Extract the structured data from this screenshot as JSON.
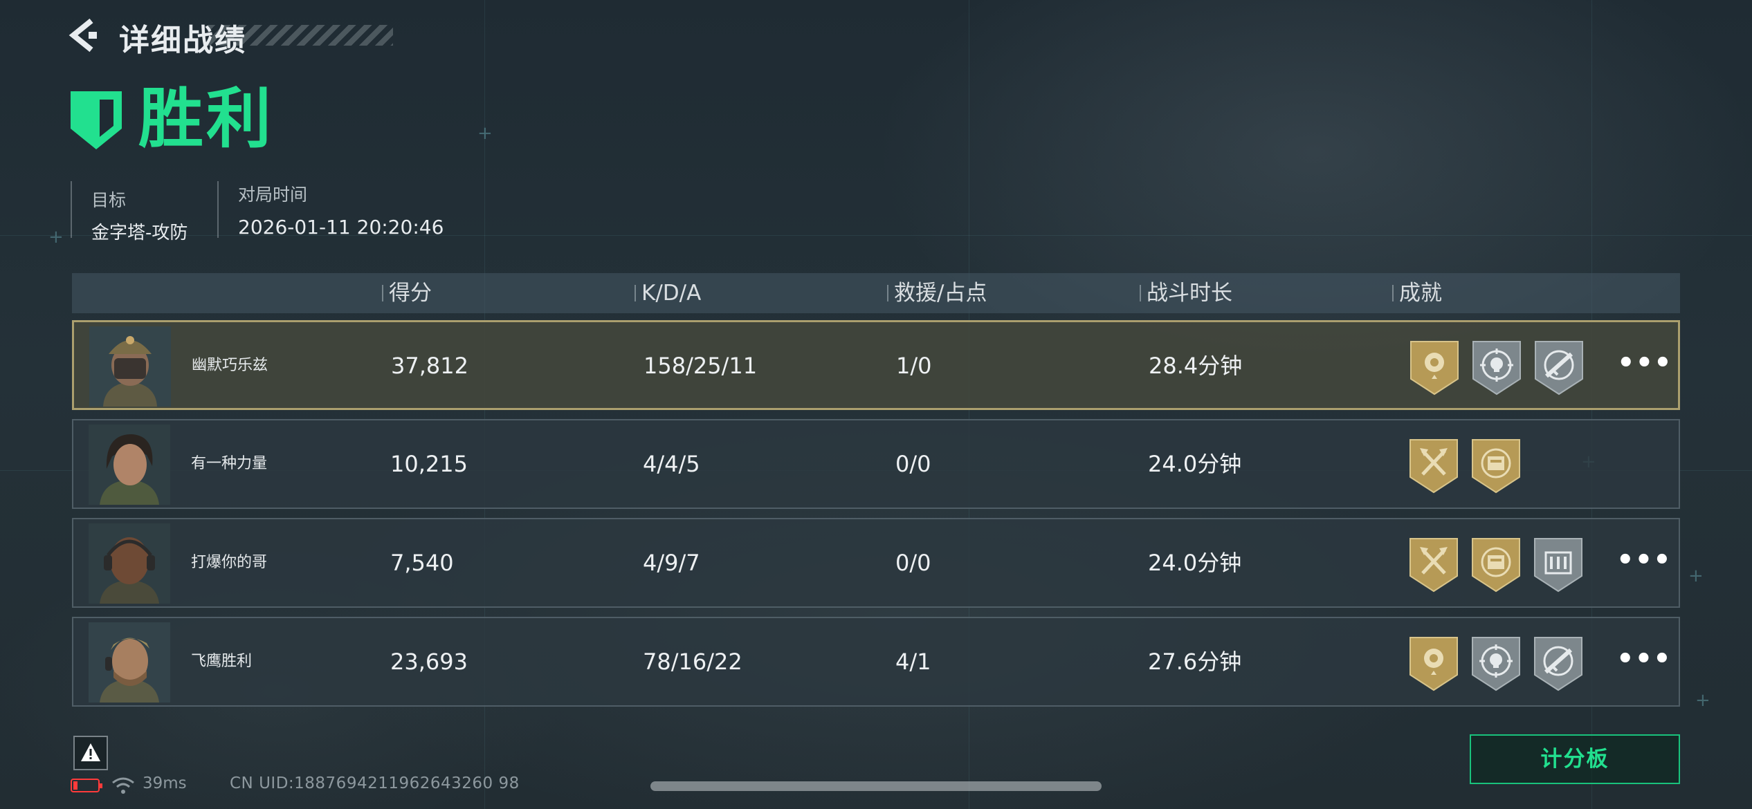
{
  "header": {
    "back_title": "详细战绩",
    "result": "胜利",
    "result_color": "#22e08f"
  },
  "match_info": {
    "objective_label": "目标",
    "objective_value": "金字塔-攻防",
    "time_label": "对局时间",
    "time_value": "2026-01-11 20:20:46"
  },
  "table": {
    "columns": [
      "得分",
      "K/D/A",
      "救援/占点",
      "战斗时长",
      "成就"
    ],
    "rows": [
      {
        "name": "幽默巧乐兹",
        "score": "37,812",
        "kda": "158/25/11",
        "rescue": "1/0",
        "duration": "28.4分钟",
        "badges": [
          "gold-rose-badge-icon",
          "silver-skull-target-badge-icon",
          "silver-rifle-target-badge-icon"
        ],
        "more": "•••",
        "highlight": true
      },
      {
        "name": "有一种力量",
        "score": "10,215",
        "kda": "4/4/5",
        "rescue": "0/0",
        "duration": "24.0分钟",
        "badges": [
          "gold-crossed-axes-badge-icon",
          "gold-supply-crate-badge-icon"
        ],
        "more": "",
        "highlight": false
      },
      {
        "name": "打爆你的哥",
        "score": "7,540",
        "kda": "4/9/7",
        "rescue": "0/0",
        "duration": "24.0分钟",
        "badges": [
          "gold-crossed-axes-badge-icon",
          "gold-supply-crate-badge-icon",
          "silver-barricade-badge-icon"
        ],
        "more": "•••",
        "highlight": false
      },
      {
        "name": "飞鹰胜利",
        "score": "23,693",
        "kda": "78/16/22",
        "rescue": "4/1",
        "duration": "27.6分钟",
        "badges": [
          "gold-rose-badge-icon",
          "silver-skull-target-badge-icon",
          "silver-rifle-target-badge-icon"
        ],
        "more": "•••",
        "highlight": false
      }
    ]
  },
  "footer": {
    "ping": "39ms",
    "uid": "CN UID:1887694211962643260 98",
    "scoreboard_label": "计分板"
  },
  "colors": {
    "accent": "#22e08f",
    "gold_badge": "#b69a56",
    "silver_badge": "#7d878c",
    "highlight_border": "#beaf78",
    "battery_low": "#ff3b3b"
  }
}
